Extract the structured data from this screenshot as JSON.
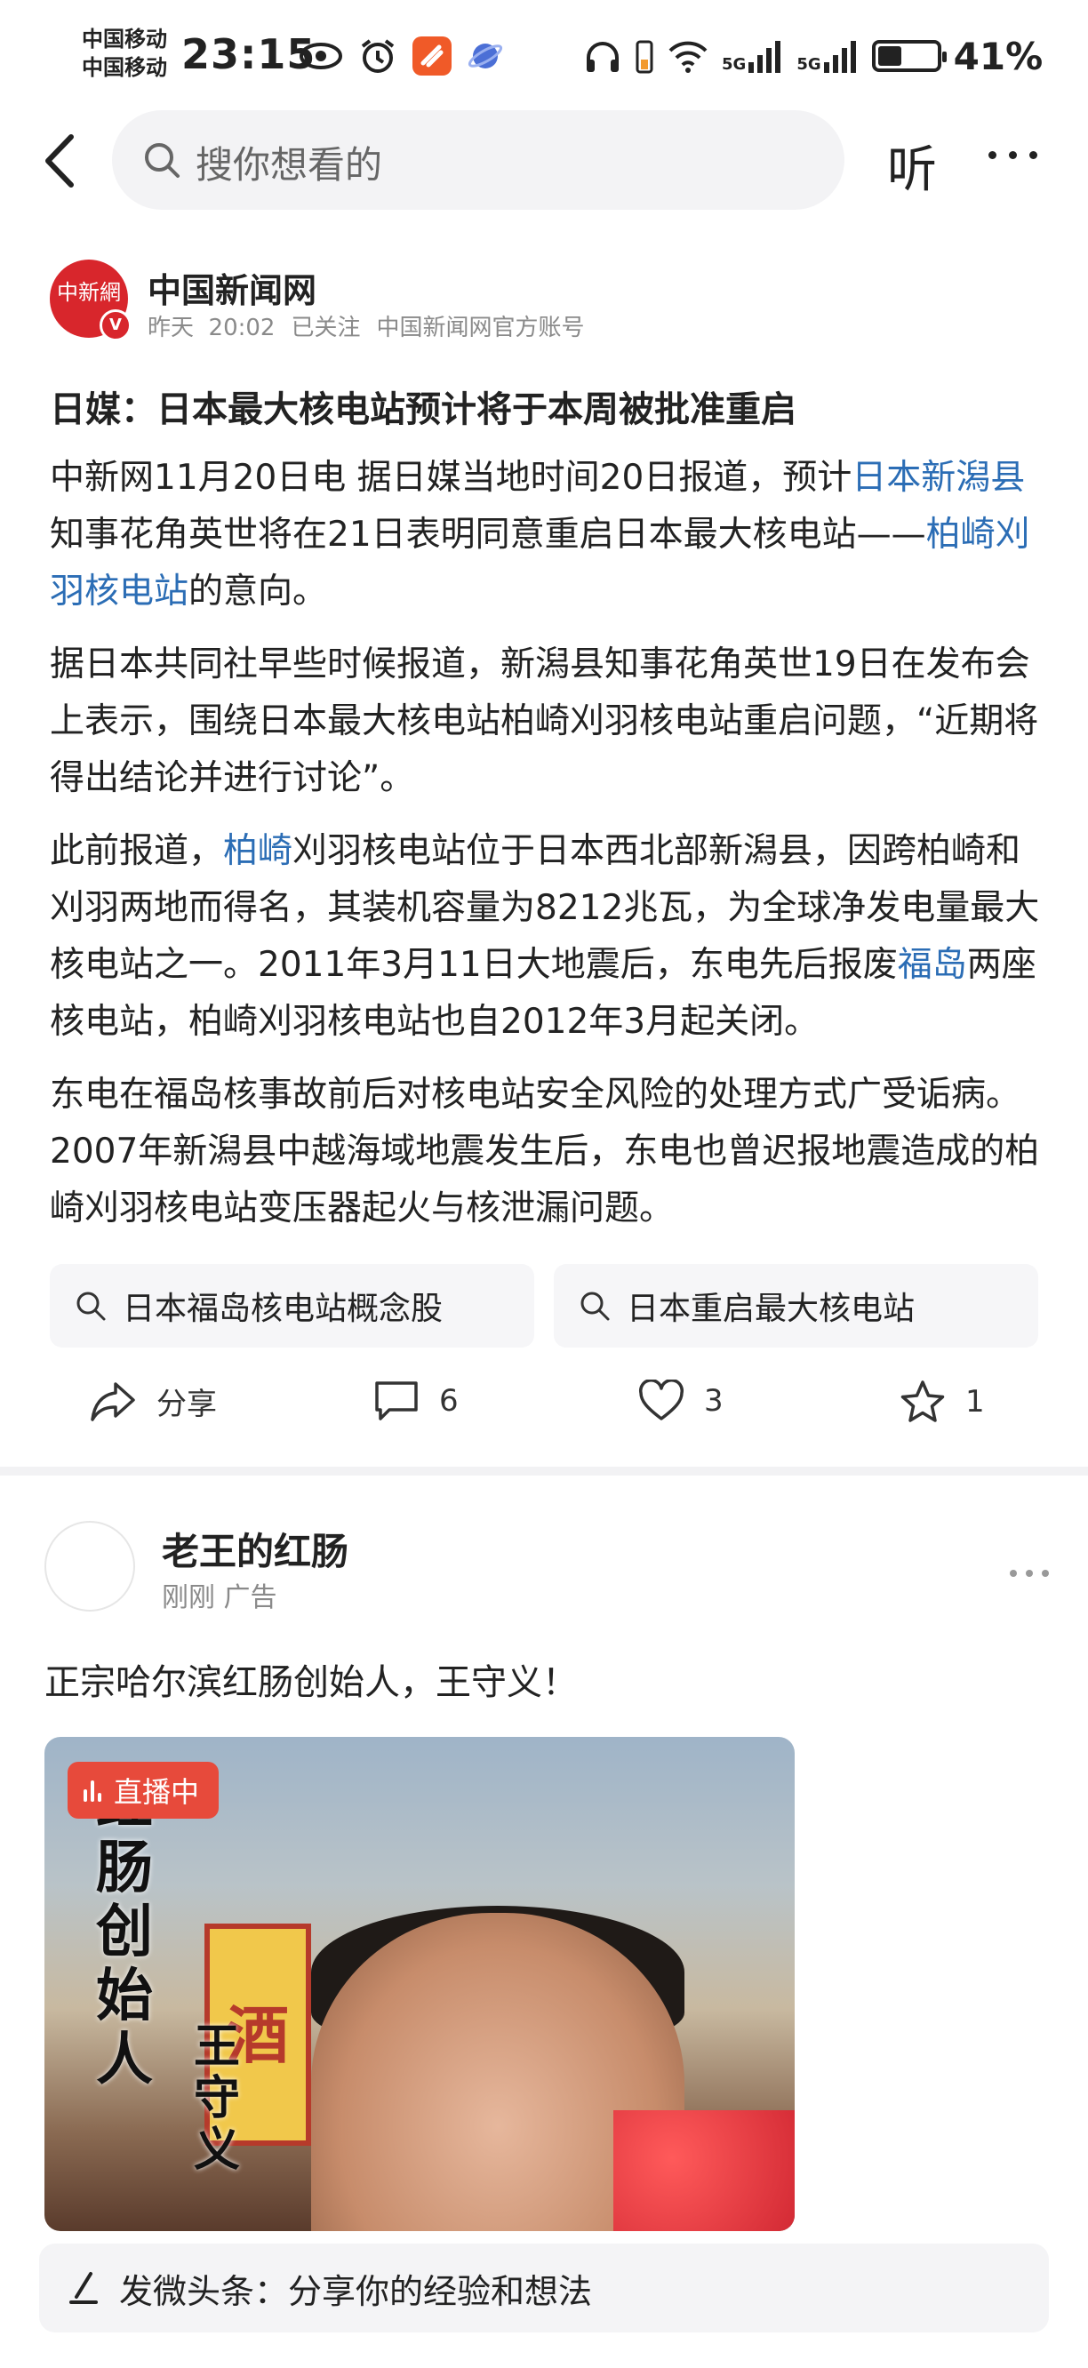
{
  "status_bar": {
    "carrier_1": "中国移动",
    "carrier_2": "中国移动",
    "time": "23:15",
    "signal_1": "5G",
    "signal_2": "5G",
    "battery_percent": "41%",
    "battery_level": 0.41
  },
  "top_bar": {
    "search_placeholder": "搜你想看的",
    "listen_label": "听"
  },
  "article": {
    "source_name": "中国新闻网",
    "logo_text": "中新網",
    "verified_badge": "V",
    "date": "昨天",
    "time": "20:02",
    "follow_status": "已关注",
    "account_desc": "中国新闻网官方账号",
    "headline": "日媒：日本最大核电站预计将于本周被批准重启",
    "p1_a": "中新网11月20日电 据日媒当地时间20日报道，预计",
    "p1_link1": "日本新潟县",
    "p1_b": "知事花角英世将在21日表明同意重启日本最大核电站——",
    "p1_link2": "柏崎刈羽核电站",
    "p1_c": "的意向。",
    "p2": "据日本共同社早些时候报道，新潟县知事花角英世19日在发布会上表示，围绕日本最大核电站柏崎刈羽核电站重启问题，“近期将得出结论并进行讨论”。",
    "p3_a": "此前报道，",
    "p3_link1": "柏崎",
    "p3_b": "刈羽核电站位于日本西北部新潟县，因跨柏崎和刈羽两地而得名，其装机容量为8212兆瓦，为全球净发电量最大核电站之一。2011年3月11日大地震后，东电先后报废",
    "p3_link2": "福岛",
    "p3_c": "两座核电站，柏崎刈羽核电站也自2012年3月起关闭。",
    "p4": "东电在福岛核事故前后对核电站安全风险的处理方式广受诟病。2007年新潟县中越海域地震发生后，东电也曾迟报地震造成的柏崎刈羽核电站变压器起火与核泄漏问题。",
    "tags": [
      "日本福岛核电站概念股",
      "日本重启最大核电站"
    ],
    "actions": {
      "share_label": "分享",
      "comment_count": "6",
      "like_count": "3",
      "favorite_count": "1"
    }
  },
  "ad": {
    "author_name": "老王的红肠",
    "meta": "刚刚 广告",
    "text": "正宗哈尔滨红肠创始人，王守义！",
    "live_label": "直播中",
    "image_text_1": "红肠创始人",
    "image_text_2": "王守义",
    "image_sign": "酒"
  },
  "bottom_bar": {
    "compose_prompt": "发微头条：分享你的经验和想法"
  }
}
